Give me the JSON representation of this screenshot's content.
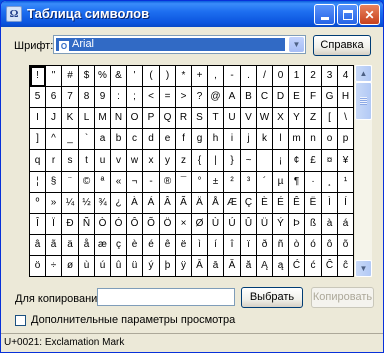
{
  "window": {
    "title": "Таблица символов",
    "app_icon": "charmap-icon"
  },
  "font": {
    "label": "Шрифт:",
    "selected": "Arial",
    "font_icon": "opentype-icon"
  },
  "buttons": {
    "help": "Справка",
    "select": "Выбрать",
    "copy": "Копировать"
  },
  "grid": {
    "selected_index": 0,
    "rows": [
      [
        "!",
        "\"",
        "#",
        "$",
        "%",
        "&",
        "'",
        "(",
        ")",
        "*",
        "+",
        ",",
        "-",
        ".",
        "/",
        "0",
        "1",
        "2",
        "3",
        "4"
      ],
      [
        "5",
        "6",
        "7",
        "8",
        "9",
        ":",
        ";",
        "<",
        "=",
        ">",
        "?",
        "@",
        "A",
        "B",
        "C",
        "D",
        "E",
        "F",
        "G",
        "H"
      ],
      [
        "I",
        "J",
        "K",
        "L",
        "M",
        "N",
        "O",
        "P",
        "Q",
        "R",
        "S",
        "T",
        "U",
        "V",
        "W",
        "X",
        "Y",
        "Z",
        "[",
        "\\"
      ],
      [
        "]",
        "^",
        "_",
        "`",
        "a",
        "b",
        "c",
        "d",
        "e",
        "f",
        "g",
        "h",
        "i",
        "j",
        "k",
        "l",
        "m",
        "n",
        "o",
        "p"
      ],
      [
        "q",
        "r",
        "s",
        "t",
        "u",
        "v",
        "w",
        "x",
        "y",
        "z",
        "{",
        "|",
        "}",
        "~",
        " ",
        "¡",
        "¢",
        "£",
        "¤",
        "¥"
      ],
      [
        "¦",
        "§",
        "¨",
        "©",
        "ª",
        "«",
        "¬",
        "-",
        "®",
        "¯",
        "°",
        "±",
        "²",
        "³",
        "´",
        "µ",
        "¶",
        "·",
        "¸",
        "¹"
      ],
      [
        "º",
        "»",
        "¼",
        "½",
        "¾",
        "¿",
        "À",
        "Á",
        "Â",
        "Ã",
        "Ä",
        "Å",
        "Æ",
        "Ç",
        "È",
        "É",
        "Ê",
        "Ë",
        "Ì",
        "Í"
      ],
      [
        "Î",
        "Ï",
        "Ð",
        "Ñ",
        "Ò",
        "Ó",
        "Ô",
        "Õ",
        "Ö",
        "×",
        "Ø",
        "Ù",
        "Ú",
        "Û",
        "Ü",
        "Ý",
        "Þ",
        "ß",
        "à",
        "á"
      ],
      [
        "â",
        "ã",
        "ä",
        "å",
        "æ",
        "ç",
        "è",
        "é",
        "ê",
        "ë",
        "ì",
        "í",
        "î",
        "ï",
        "ð",
        "ñ",
        "ò",
        "ó",
        "ô",
        "õ"
      ],
      [
        "ö",
        "÷",
        "ø",
        "ù",
        "ú",
        "û",
        "ü",
        "ý",
        "þ",
        "ÿ",
        "Ā",
        "ā",
        "Ă",
        "ă",
        "Ą",
        "ą",
        "Ć",
        "ć",
        "Ĉ",
        "ĉ"
      ]
    ]
  },
  "copy": {
    "label": "Для копирования:",
    "value": ""
  },
  "advanced": {
    "label": "Дополнительные параметры просмотра",
    "checked": false
  },
  "status": "U+0021: Exclamation Mark",
  "colors": {
    "titlebar": "#0b54de",
    "window_bg": "#ece9d8",
    "selection": "#316ac5"
  }
}
